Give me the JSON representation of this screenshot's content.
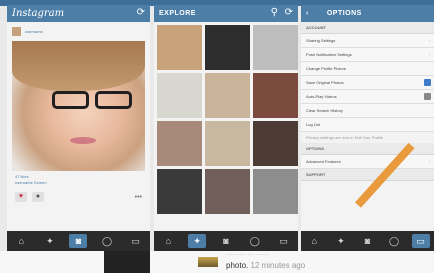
{
  "feed": {
    "logo": "Instagram",
    "username": "username",
    "likes": "47 likes",
    "caption": "username Screen",
    "more": "•••"
  },
  "explore": {
    "title": "EXPLORE"
  },
  "options": {
    "title": "OPTIONS",
    "account_label": "ACCOUNT",
    "items": [
      "Sharing Settings",
      "Push Notification Settings",
      "Change Profile Picture",
      "Save Original Photos",
      "Auto-Play Videos",
      "Clear Search History",
      "Log Out"
    ],
    "note": "Privacy settings are now in Edit Your Profile",
    "options_label": "OPTIONS",
    "advanced": "Advanced Features",
    "support_label": "SUPPORT"
  },
  "post": {
    "faint": "............ .... ........",
    "text": "photo.",
    "time": "12 minutes ago"
  },
  "colors": {
    "header": "#4d7ea8",
    "tabbar": "#2b2b2b",
    "checkbox_on": "#3c7cc8",
    "accent_orange": "#e89a3c"
  }
}
